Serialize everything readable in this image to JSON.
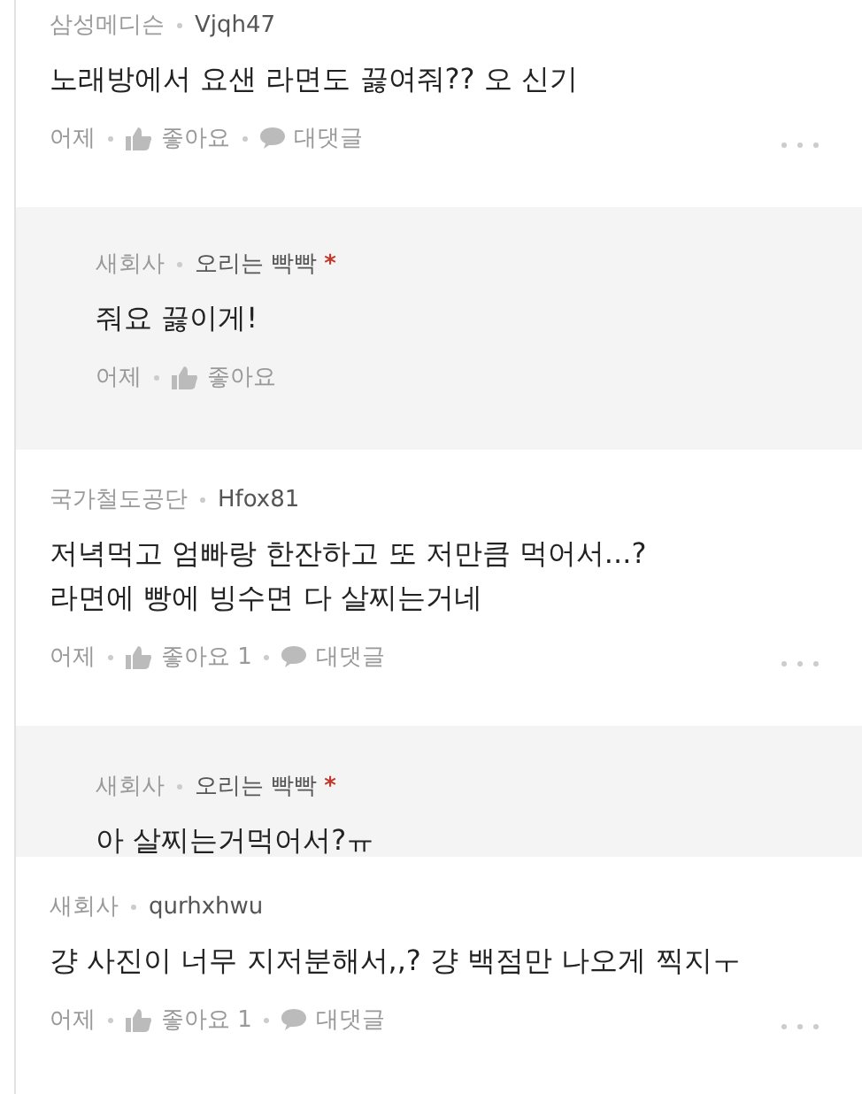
{
  "comments": [
    {
      "kind": "comment",
      "company": "삼성메디슨",
      "user": "Vjqh47",
      "text": [
        "노래방에서 요샌 라면도 끓여줘?? 오 신기"
      ],
      "time": "어제",
      "like": "좋아요",
      "reply": "대댓글"
    },
    {
      "kind": "reply",
      "company": "새회사",
      "user": "오리는 빡빡",
      "author_mark": "*",
      "text": [
        "줘요 끓이게!"
      ],
      "time": "어제",
      "like": "좋아요"
    },
    {
      "kind": "comment",
      "company": "국가철도공단",
      "user": "Hfox81",
      "text": [
        "저녁먹고 엄빠랑 한잔하고 또 저만큼 먹어서...?",
        "라면에 빵에 빙수면 다 살찌는거네"
      ],
      "time": "어제",
      "like": "좋아요 1",
      "reply": "대댓글"
    },
    {
      "kind": "reply",
      "company": "새회사",
      "user": "오리는 빡빡",
      "author_mark": "*",
      "text": [
        "아 살찌는거먹어서?ㅠ"
      ]
    },
    {
      "kind": "comment",
      "company": "새회사",
      "user": "qurhxhwu",
      "text": [
        "걍 사진이 너무 지저분해서,,? 걍 백점만 나오게 찍지ㅜ"
      ],
      "time": "어제",
      "like": "좋아요 1",
      "reply": "대댓글"
    }
  ]
}
